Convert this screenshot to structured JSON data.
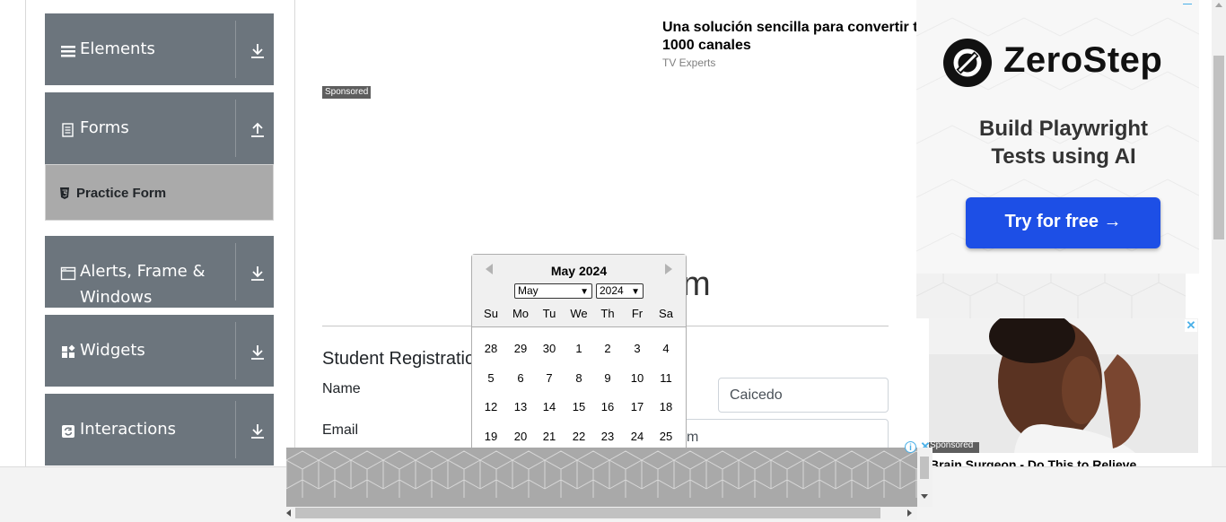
{
  "sidebar": {
    "groups": [
      {
        "title": "Elements",
        "icon": "list-icon",
        "arrow": "down"
      },
      {
        "title": "Forms",
        "icon": "document-icon",
        "arrow": "up"
      },
      {
        "title": "Alerts, Frame & Windows",
        "title_line1": "Alerts, Frame &",
        "title_line2": "Windows",
        "icon": "window-icon",
        "arrow": "down"
      },
      {
        "title": "Widgets",
        "icon": "widgets-icon",
        "arrow": "down"
      },
      {
        "title": "Interactions",
        "icon": "interactions-icon",
        "arrow": "down"
      }
    ],
    "active_item": {
      "label": "Practice Form",
      "icon": "html5-icon"
    }
  },
  "top_ad": {
    "title_line1": "Una solución sencilla para convertir t",
    "title_line2": "1000 canales",
    "source": "TV Experts",
    "sponsored": "Sponsored"
  },
  "main": {
    "page_title_fragment": "m",
    "form_heading": "Student Registratio",
    "name_label": "Name",
    "last_name_value": "Caicedo",
    "email_label": "Email",
    "email_value_fragment": "m"
  },
  "datepicker": {
    "header": "May 2024",
    "month_selected": "May",
    "year_selected": "2024",
    "day_names": [
      "Su",
      "Mo",
      "Tu",
      "We",
      "Th",
      "Fr",
      "Sa"
    ],
    "weeks": [
      [
        "28",
        "29",
        "30",
        "1",
        "2",
        "3",
        "4"
      ],
      [
        "5",
        "6",
        "7",
        "8",
        "9",
        "10",
        "11"
      ],
      [
        "12",
        "13",
        "14",
        "15",
        "16",
        "17",
        "18"
      ],
      [
        "19",
        "20",
        "21",
        "22",
        "23",
        "24",
        "25"
      ]
    ]
  },
  "right_ad": {
    "brand": "ZeroStep",
    "tagline": "Build Playwright Tests using AI",
    "tagline_line1": "Build Playwright",
    "tagline_line2": "Tests using AI",
    "cta": "Try for free →"
  },
  "photo_ad": {
    "sponsored": "Sponsored",
    "caption": "Brain Surgeon - Do This to Relieve"
  },
  "colors": {
    "sidebar_group": "#6c757d",
    "active_item": "#aaaaaa",
    "cta_blue": "#1d4fe6"
  }
}
